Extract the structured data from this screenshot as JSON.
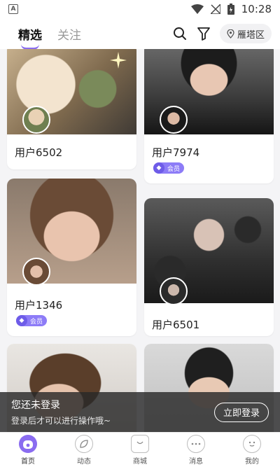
{
  "status_bar": {
    "time": "10:28",
    "left_icon_letter": "A"
  },
  "header": {
    "tabs": [
      {
        "label": "精选",
        "active": true
      },
      {
        "label": "关注",
        "active": false
      }
    ],
    "location": "雁塔区"
  },
  "cards": [
    {
      "name": "用户6502",
      "vip": false
    },
    {
      "name": "用户7974",
      "vip": true,
      "vip_label": "会员"
    },
    {
      "name": "用户1346",
      "vip": true,
      "vip_label": "会员"
    },
    {
      "name": "用户6501",
      "vip": false
    }
  ],
  "login_prompt": {
    "title": "您还未登录",
    "subtitle": "登录后才可以进行操作哦~",
    "button": "立即登录"
  },
  "bottom_nav": [
    {
      "label": "首页",
      "icon": "home-icon",
      "active": true
    },
    {
      "label": "动态",
      "icon": "leaf-icon",
      "active": false
    },
    {
      "label": "商城",
      "icon": "shop-bag-icon",
      "active": false
    },
    {
      "label": "消息",
      "icon": "chat-bubble-icon",
      "active": false
    },
    {
      "label": "我的",
      "icon": "profile-face-icon",
      "active": false
    }
  ],
  "colors": {
    "accent": "#8a6cf0",
    "vip_badge": "#8d7cf7"
  }
}
